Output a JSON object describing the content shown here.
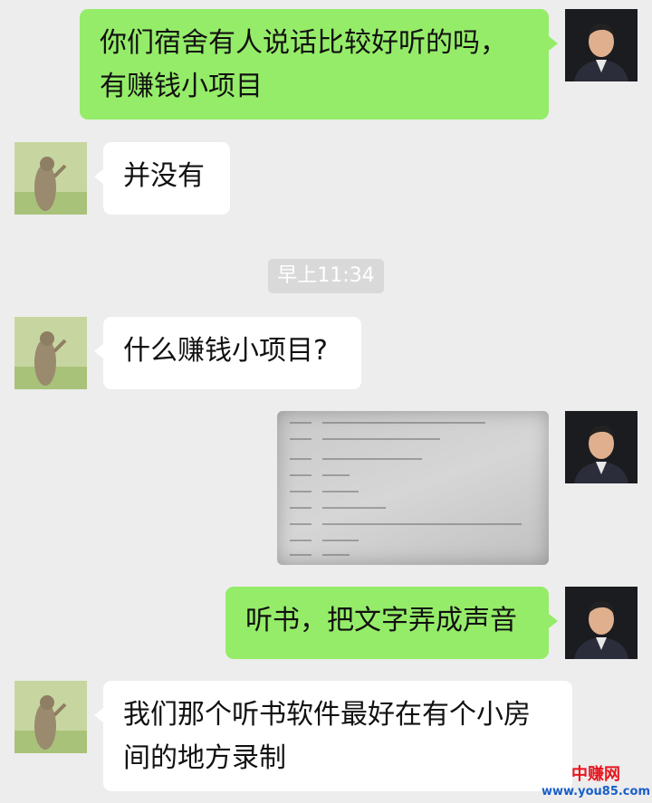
{
  "messages": [
    {
      "side": "right",
      "text": "你们宿舍有人说话比较好听的吗，\n有赚钱小项目"
    },
    {
      "side": "left",
      "text": "并没有"
    },
    {
      "side": "left",
      "text": "什么赚钱小项目?"
    },
    {
      "side": "right",
      "text": "听书，把文字弄成声音"
    },
    {
      "side": "left",
      "text": "我们那个听书软件最好在有个小房\n间的地方录制"
    }
  ],
  "timestamp": "早上11:34",
  "image_message": {
    "kind": "photo of a document form",
    "side": "right"
  },
  "avatars": {
    "self": "man-avatar-icon",
    "contact": "groundhog-avatar-icon"
  },
  "watermark": {
    "title": "中赚网",
    "url": "www.you85.com"
  },
  "colors": {
    "background": "#ededed",
    "outgoing_bubble": "#95ec69",
    "incoming_bubble": "#ffffff"
  }
}
